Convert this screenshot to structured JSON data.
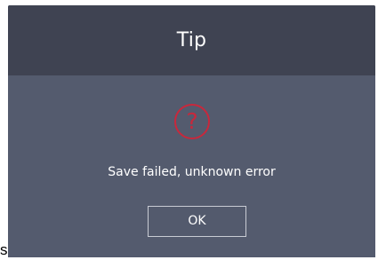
{
  "background_text": "s",
  "dialog": {
    "title": "Tip",
    "icon": "question-mark-circle-icon",
    "icon_glyph": "?",
    "message": "Save failed, unknown error",
    "ok_label": "OK"
  },
  "colors": {
    "header_bg": "#3f4352",
    "body_bg": "#545b6e",
    "icon": "#c8283c",
    "text": "#ffffff"
  }
}
